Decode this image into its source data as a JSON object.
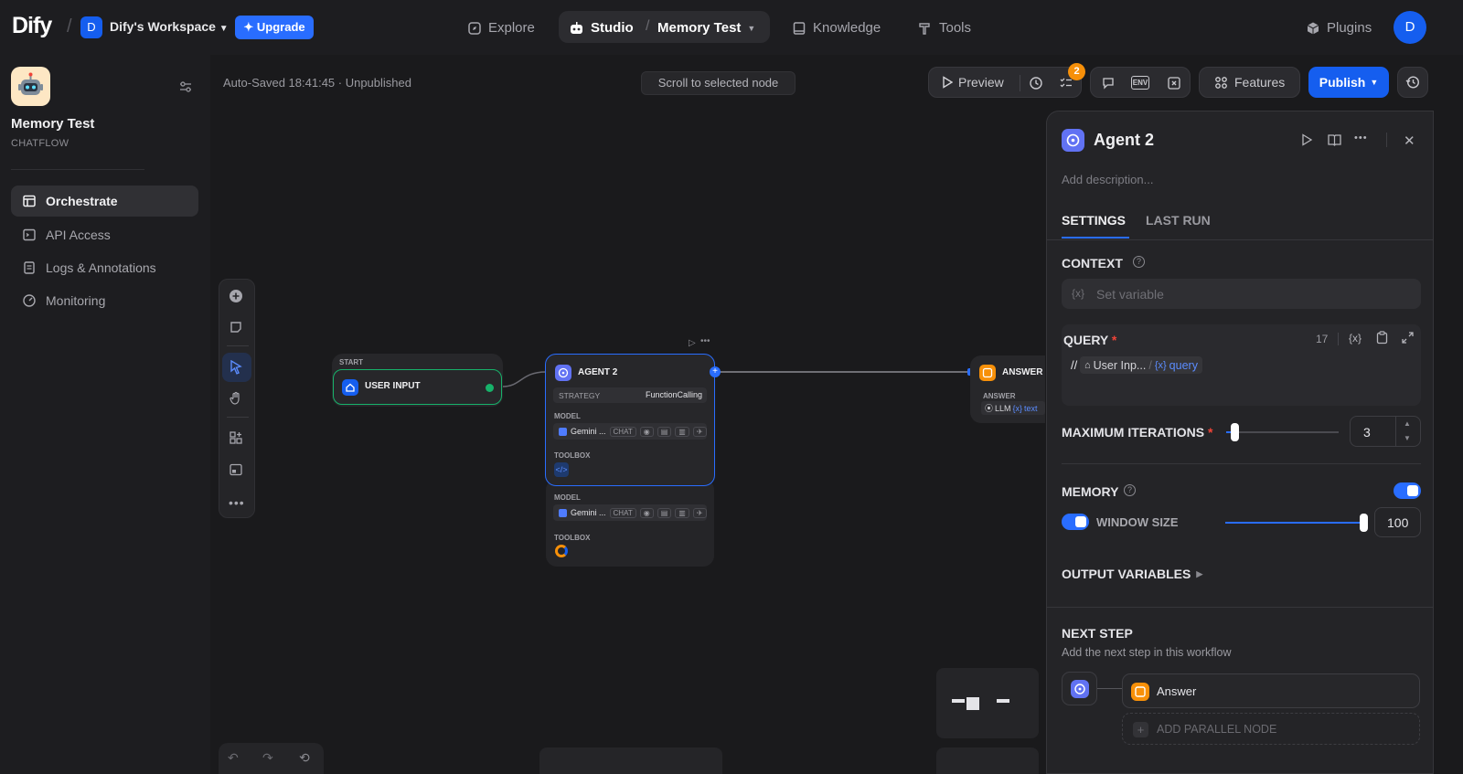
{
  "nav": {
    "logo": "Dify",
    "workspace_initial": "D",
    "workspace_name": "Dify's Workspace",
    "upgrade_label": "Upgrade",
    "explore": "Explore",
    "studio": "Studio",
    "separator": "/",
    "app_name": "Memory Test",
    "knowledge": "Knowledge",
    "tools": "Tools",
    "plugins": "Plugins",
    "user_initial": "D"
  },
  "sidebar": {
    "app_title": "Memory Test",
    "app_type": "CHATFLOW",
    "items": [
      {
        "label": "Orchestrate",
        "icon": "layout-icon",
        "active": true
      },
      {
        "label": "API Access",
        "icon": "terminal-icon",
        "active": false
      },
      {
        "label": "Logs & Annotations",
        "icon": "document-icon",
        "active": false
      },
      {
        "label": "Monitoring",
        "icon": "gauge-icon",
        "active": false
      }
    ]
  },
  "canvas": {
    "status": "Auto-Saved 18:41:45 · Unpublished",
    "scroll_btn": "Scroll to selected node",
    "preview_label": "Preview",
    "checklist_badge": "2",
    "env_label": "ENV",
    "features_label": "Features",
    "publish_label": "Publish"
  },
  "nodes": {
    "start": {
      "header": "START",
      "title": "USER INPUT"
    },
    "agent": {
      "title": "AGENT 2",
      "strategy_label": "STRATEGY",
      "strategy_value": "FunctionCalling",
      "model_label": "MODEL",
      "model_name": "Gemini ...",
      "model_chip": "CHAT",
      "toolbox_label": "TOOLBOX"
    },
    "agent_ghost": {
      "model_label": "MODEL",
      "model_name": "Gemini ...",
      "model_chip": "CHAT",
      "toolbox_label": "TOOLBOX"
    },
    "answer": {
      "title": "ANSWER",
      "field_label": "ANSWER",
      "var_source": "LLM",
      "var_name": "text"
    }
  },
  "panel": {
    "title": "Agent 2",
    "description_placeholder": "Add description...",
    "tabs": [
      "SETTINGS",
      "LAST RUN"
    ],
    "context_label": "CONTEXT",
    "context_placeholder": "Set variable",
    "var_glyph": "{x}",
    "query_label": "QUERY",
    "required_mark": "*",
    "query_count": "17",
    "query_prefix": "//",
    "query_node": "User Inp...",
    "query_var": "query",
    "max_iter_label": "MAXIMUM ITERATIONS",
    "max_iter_value": "3",
    "max_iter_fraction": 0.08,
    "memory_label": "MEMORY",
    "memory_enabled": true,
    "window_size_label": "WINDOW SIZE",
    "window_size_value": "100",
    "window_size_fraction": 1.0,
    "output_vars_label": "OUTPUT VARIABLES",
    "next_step_label": "NEXT STEP",
    "next_step_desc": "Add the next step in this workflow",
    "next_node": "Answer",
    "add_parallel": "ADD PARALLEL NODE"
  },
  "colors": {
    "accent": "#296dff",
    "agent": "#6172f3",
    "answer": "#f79009",
    "start": "#155eef",
    "success": "#17b26a"
  }
}
